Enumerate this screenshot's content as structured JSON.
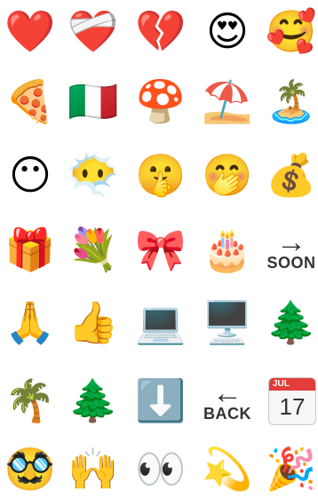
{
  "rows": [
    [
      {
        "icon": "red-heart-icon",
        "glyph": "❤️"
      },
      {
        "icon": "mending-heart-icon",
        "glyph": "❤️‍🩹"
      },
      {
        "icon": "broken-heart-icon",
        "glyph": "💔"
      },
      {
        "icon": "heart-eyes-face-icon",
        "glyph": "😍"
      },
      {
        "icon": "smiling-face-with-hearts-icon",
        "glyph": "🥰"
      }
    ],
    [
      {
        "icon": "pizza-icon",
        "glyph": "🍕"
      },
      {
        "icon": "italy-flag-icon",
        "glyph": "🇮🇹"
      },
      {
        "icon": "mushroom-icon",
        "glyph": "🍄"
      },
      {
        "icon": "beach-umbrella-icon",
        "glyph": "⛱️"
      },
      {
        "icon": "desert-island-icon",
        "glyph": "🏝️"
      }
    ],
    [
      {
        "icon": "face-without-mouth-icon",
        "glyph": "😶"
      },
      {
        "icon": "face-in-clouds-icon",
        "glyph": "😶‍🌫️"
      },
      {
        "icon": "shushing-face-icon",
        "glyph": "🤫"
      },
      {
        "icon": "face-with-hand-over-mouth-icon",
        "glyph": "🤭"
      },
      {
        "icon": "money-bag-icon",
        "glyph": "💰"
      }
    ],
    [
      {
        "icon": "wrapped-gift-icon",
        "glyph": "🎁"
      },
      {
        "icon": "bouquet-icon",
        "glyph": "💐"
      },
      {
        "icon": "ribbon-icon",
        "glyph": "🎀"
      },
      {
        "icon": "birthday-cake-icon",
        "glyph": "🎂"
      },
      {
        "icon": "soon-arrow-icon",
        "glyph": "→",
        "word": "SOON"
      }
    ],
    [
      {
        "icon": "folded-hands-icon",
        "glyph": "🙏"
      },
      {
        "icon": "thumbs-up-icon",
        "glyph": "👍"
      },
      {
        "icon": "laptop-icon",
        "glyph": "💻"
      },
      {
        "icon": "desktop-computer-icon",
        "glyph": "🖥️"
      },
      {
        "icon": "evergreen-tree-icon",
        "glyph": "🌲"
      }
    ],
    [
      {
        "icon": "palm-tree-icon",
        "glyph": "🌴"
      },
      {
        "icon": "evergreen-tree-icon",
        "glyph": "🌲"
      },
      {
        "icon": "down-arrow-button-icon",
        "glyph": "⬇️"
      },
      {
        "icon": "back-arrow-icon",
        "glyph": "←",
        "word": "BACK"
      },
      {
        "icon": "calendar-icon",
        "month": "JUL",
        "day": "17"
      }
    ],
    [
      {
        "icon": "disguised-face-icon",
        "glyph": "🥸"
      },
      {
        "icon": "raising-hands-icon",
        "glyph": "🙌"
      },
      {
        "icon": "eyes-icon",
        "glyph": "👀"
      },
      {
        "icon": "dizzy-icon",
        "glyph": "💫"
      },
      {
        "icon": "party-popper-icon",
        "glyph": "🎉"
      }
    ]
  ]
}
